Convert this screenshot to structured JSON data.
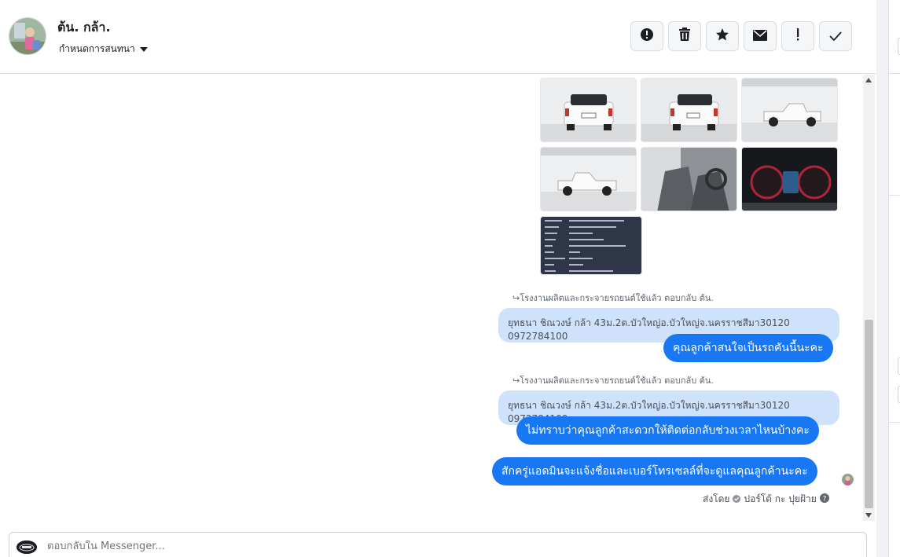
{
  "header": {
    "contact_name": "ต้น. กล้า.",
    "assign_label": "กำหนดการสนทนา",
    "toolbar": [
      {
        "icon": "alert-circle-icon",
        "name": "spam-button"
      },
      {
        "icon": "trash-icon",
        "name": "delete-button"
      },
      {
        "icon": "star-icon",
        "name": "star-button"
      },
      {
        "icon": "envelope-icon",
        "name": "mark-unread-button"
      },
      {
        "icon": "exclamation-icon",
        "name": "follow-up-button"
      },
      {
        "icon": "check-icon",
        "name": "mark-done-button"
      }
    ]
  },
  "thread": {
    "reply_note_1": "โรงงานผลิตและกระจายรถยนต์ใช้แล้ว ตอบกลับ ต้น.",
    "quote_1": "ยุทธนา ชิณวงษ์ กล้า 43ม.2ต.บัวใหญ่อ.บัวใหญ่จ.นครราชสีมา30120 0972784100",
    "message_1": "คุณลูกค้าสนใจเป็นรถคันนี้นะคะ",
    "reply_note_2": "โรงงานผลิตและกระจายรถยนต์ใช้แล้ว ตอบกลับ ต้น.",
    "quote_2": "ยุทธนา ชิณวงษ์ กล้า 43ม.2ต.บัวใหญ่อ.บัวใหญ่จ.นครราชสีมา30120 0972784100",
    "message_2": "ไม่ทราบว่าคุณลูกค้าสะดวกให้ติดต่อกลับช่วงเวลาไหนบ้างคะ",
    "message_3": "สักครู่แอดมินจะแจ้งชื่อและเบอร์โทรเซลล์ที่จะดูแลคุณลูกค้านะคะ",
    "sent_by_label": "ส่งโดย",
    "sent_by_name": "ปอร์โต้ กะ ปุยฝ้าย"
  },
  "composer": {
    "placeholder": "ตอบกลับใน Messenger..."
  },
  "colors": {
    "brand_blue": "#1877f2",
    "quote_bg": "#cfe2fb"
  }
}
